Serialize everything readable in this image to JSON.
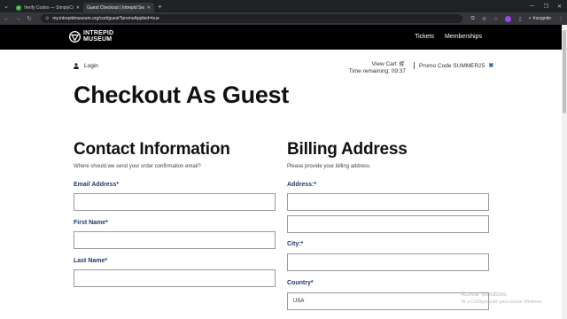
{
  "browser": {
    "tabs": [
      {
        "title": "Verify Codes — SimplyCodes",
        "active": false
      },
      {
        "title": "Guest Checkout | Intrepid Sea...",
        "active": true
      }
    ],
    "url": "my.intrepidmuseum.org/cart/guest?promoApplied=true",
    "profile": "Incognito"
  },
  "header": {
    "logo_line1": "INTREPID",
    "logo_line2": "MUSEUM",
    "nav": [
      "Tickets",
      "Memberships"
    ]
  },
  "top_bar": {
    "login": "Login",
    "view_cart": "View Cart",
    "time_remaining": "Time remaining: 09:37",
    "promo": "Promo Code SUMMER25"
  },
  "page_title": "Checkout As Guest",
  "contact": {
    "title": "Contact Information",
    "subtitle": "Where should we send your order confirmation email?",
    "fields": [
      {
        "label": "Email Address*",
        "value": ""
      },
      {
        "label": "First Name*",
        "value": ""
      },
      {
        "label": "Last Name*",
        "value": ""
      }
    ]
  },
  "billing": {
    "title": "Billing Address",
    "subtitle": "Please provide your billing address.",
    "address_label": "Address:*",
    "address1": "",
    "address2": "",
    "city_label": "City:*",
    "city": "",
    "country_label": "Country*",
    "country": "USA"
  },
  "watermark": {
    "line1": "Activar Windows",
    "line2": "Ve a Configuración para activar Windows."
  }
}
